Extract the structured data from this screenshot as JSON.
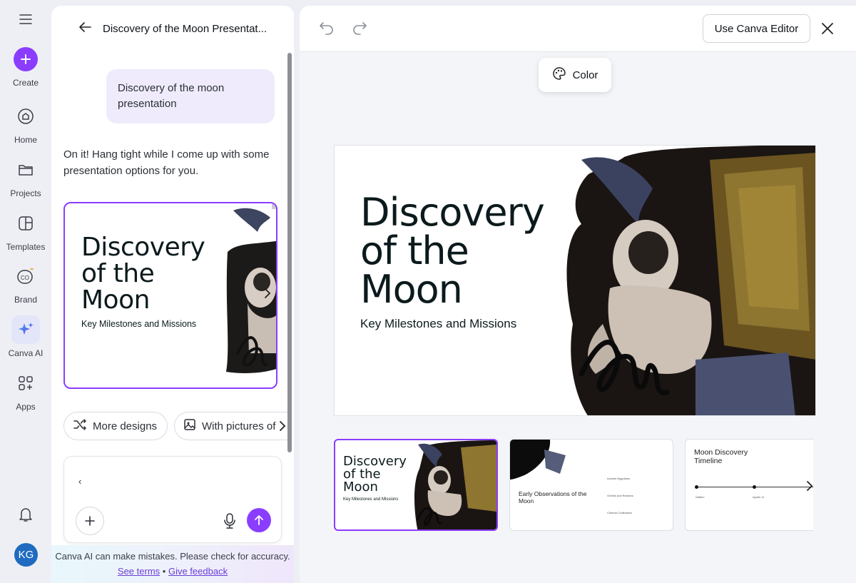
{
  "rail": {
    "create": "Create",
    "home": "Home",
    "projects": "Projects",
    "templates": "Templates",
    "brand": "Brand",
    "canva_ai": "Canva AI",
    "apps": "Apps",
    "avatar_initials": "KG"
  },
  "panel": {
    "title": "Discovery of the Moon Presentat...",
    "user_message": "Discovery of the moon presentation",
    "ai_message": "On it! Hang tight while I come up with some presentation options for you.",
    "preview": {
      "title_lines": [
        "Discovery",
        "of the",
        "Moon"
      ],
      "subtitle": "Key Milestones and Missions"
    },
    "chips": {
      "more_designs": "More designs",
      "with_pictures": "With pictures of"
    },
    "input_value": "‹",
    "footer_text": "Canva AI can make mistakes. Please check for accuracy.",
    "see_terms": "See terms",
    "separator": "•",
    "give_feedback": "Give feedback"
  },
  "editor": {
    "use_editor_button": "Use Canva Editor",
    "color_button": "Color",
    "slide": {
      "title_lines": [
        "Discovery",
        "of the",
        "Moon"
      ],
      "subtitle": "Key Milestones and Missions"
    },
    "thumbnails": [
      {
        "title_lines": [
          "Discovery",
          "of the",
          "Moon"
        ],
        "subtitle": "Key Milestones and Missions",
        "selected": true
      },
      {
        "heading": "Early Observations of the Moon",
        "items": [
          "Ancient Egyptians",
          "Greeks and Romans",
          "Chinese Civilization"
        ]
      },
      {
        "heading": "Moon Discovery Timeline",
        "items": [
          "Galileo",
          "Apollo 11"
        ]
      }
    ]
  },
  "colors": {
    "accent": "#8b3dff",
    "rail_bg": "#eeeff5",
    "slide_dark": "#0c1a1d",
    "avatar": "#1f6bbf"
  }
}
